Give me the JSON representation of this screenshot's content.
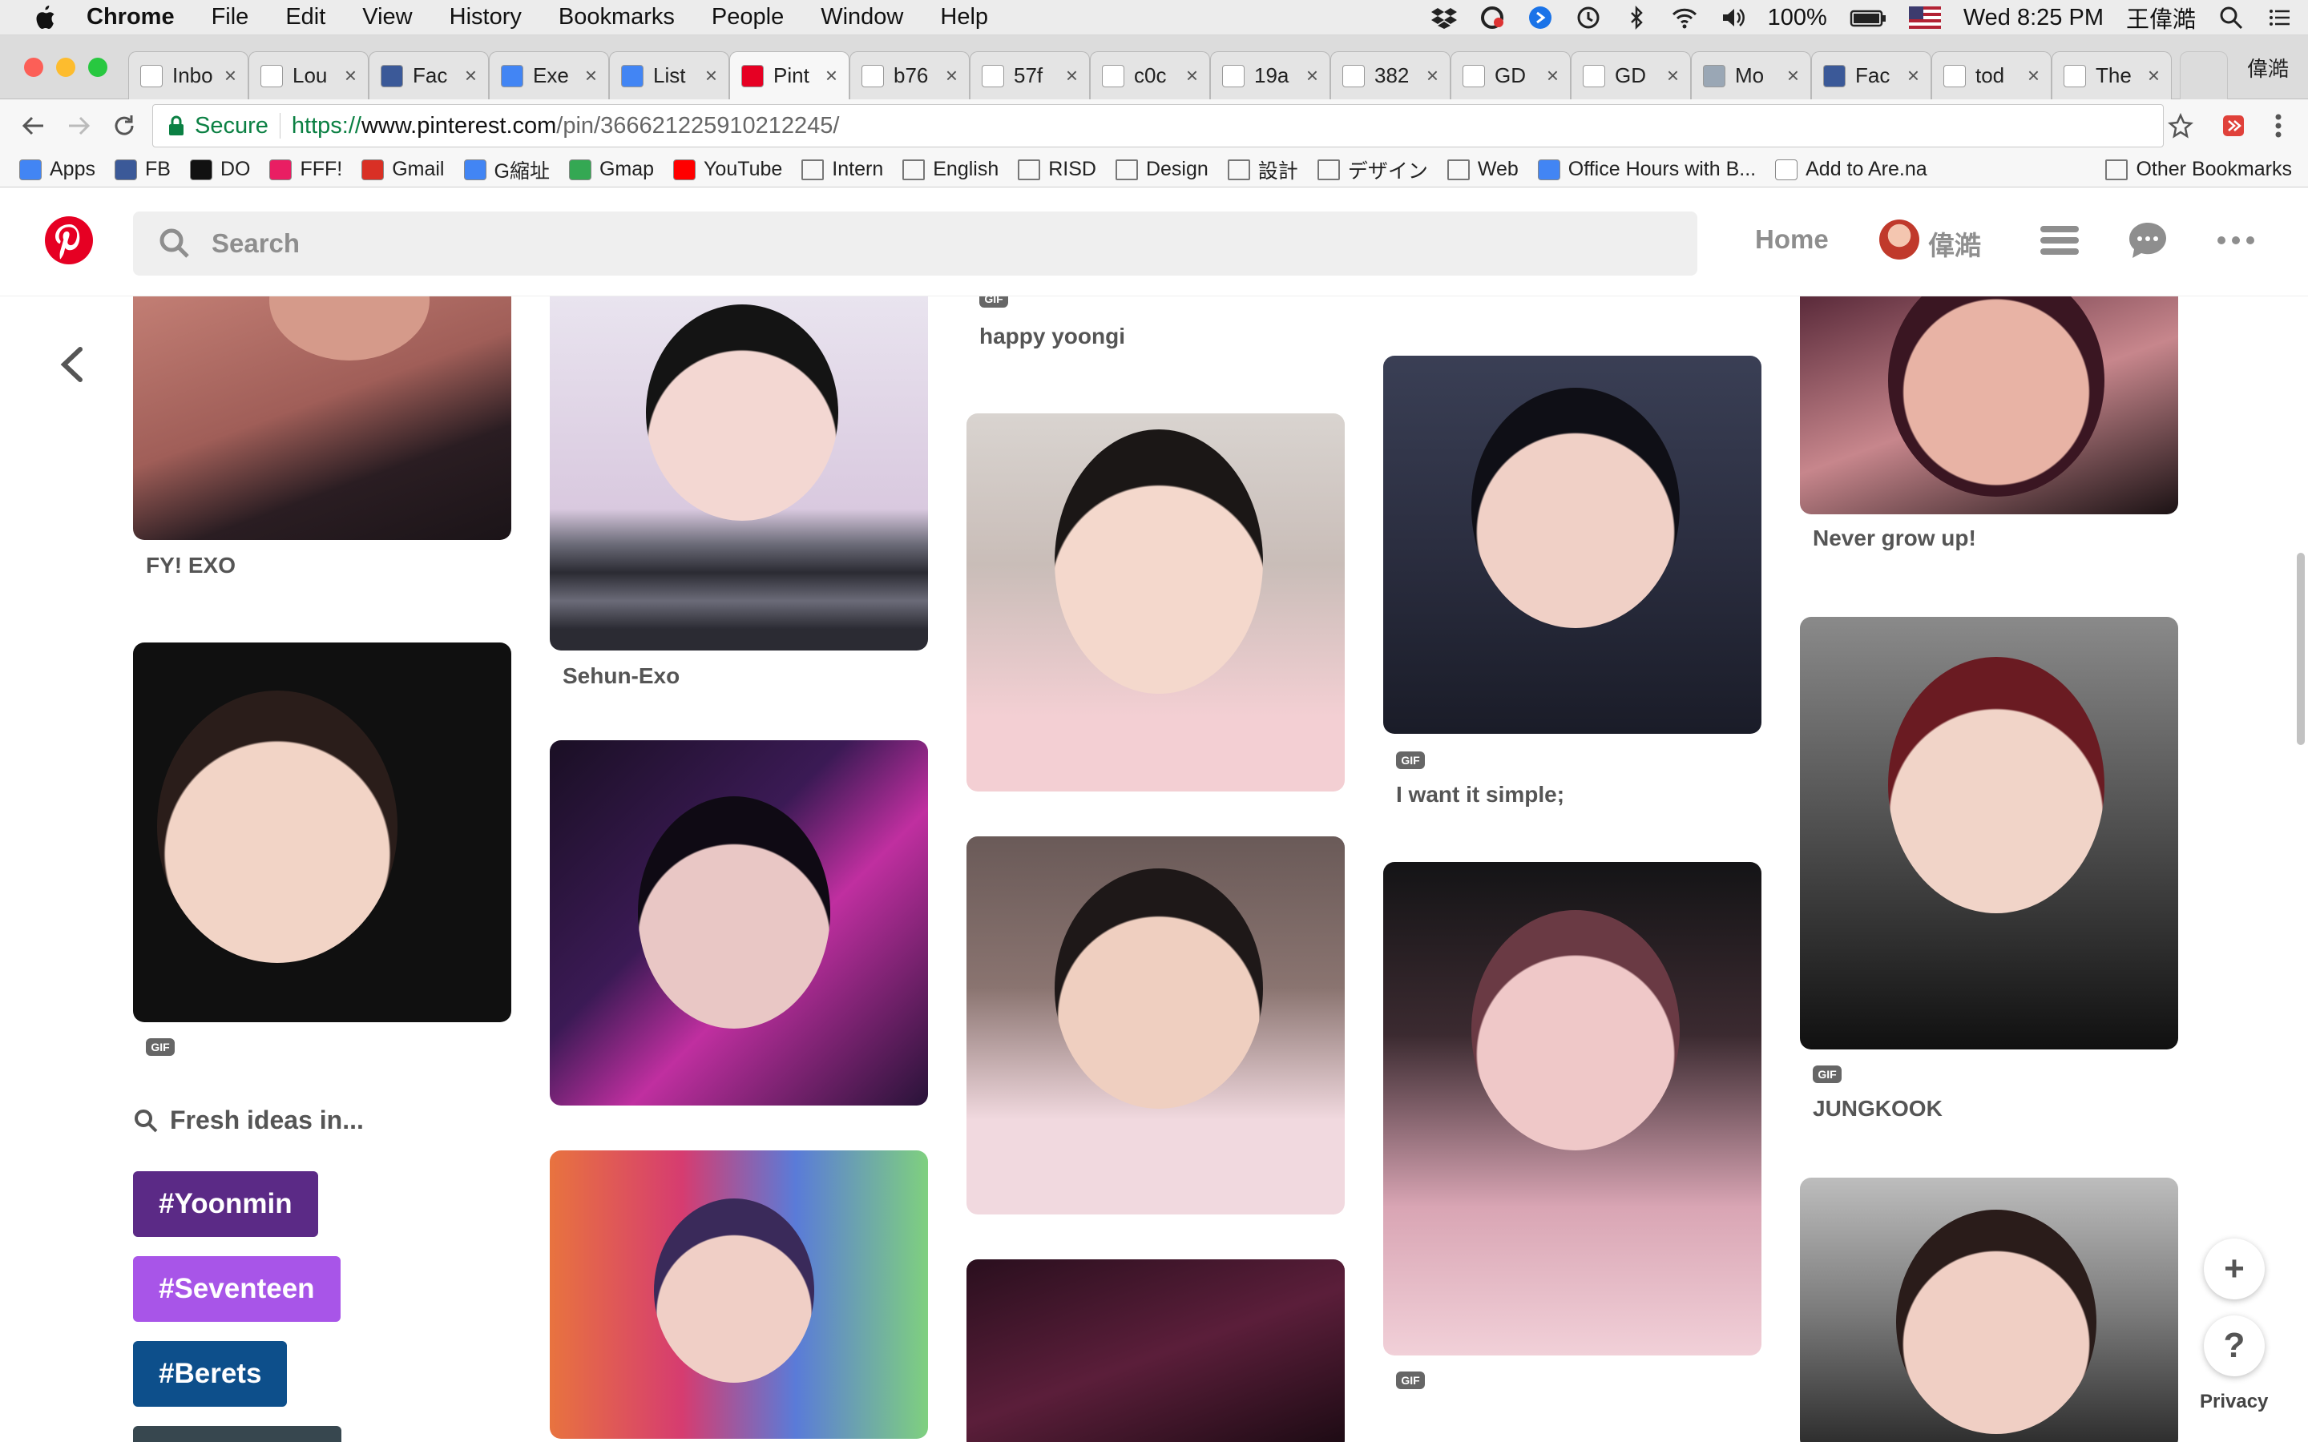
{
  "menubar": {
    "app": "Chrome",
    "items": [
      "File",
      "Edit",
      "View",
      "History",
      "Bookmarks",
      "People",
      "Window",
      "Help"
    ],
    "battery": "100%",
    "clock": "Wed 8:25 PM",
    "user": "王偉澔"
  },
  "tabs": [
    {
      "label": "Inbo",
      "icon": "gmail-icon"
    },
    {
      "label": "Lou",
      "icon": "gmail-icon"
    },
    {
      "label": "Fac",
      "icon": "facebook-icon"
    },
    {
      "label": "Exe",
      "icon": "docs-icon"
    },
    {
      "label": "List",
      "icon": "docs-icon"
    },
    {
      "label": "Pint",
      "icon": "pinterest-icon",
      "active": true
    },
    {
      "label": "b76",
      "icon": "page-icon"
    },
    {
      "label": "57f",
      "icon": "page-icon"
    },
    {
      "label": "c0c",
      "icon": "page-icon"
    },
    {
      "label": "19a",
      "icon": "page-icon"
    },
    {
      "label": "382",
      "icon": "page-icon"
    },
    {
      "label": "GD",
      "icon": "page-icon"
    },
    {
      "label": "GD",
      "icon": "page-icon"
    },
    {
      "label": "Mo",
      "icon": "image-icon"
    },
    {
      "label": "Fac",
      "icon": "facebook-icon"
    },
    {
      "label": "tod",
      "icon": "google-icon"
    },
    {
      "label": "The",
      "icon": "wikipedia-icon"
    }
  ],
  "profile_name": "偉澔",
  "address": {
    "secure_label": "Secure",
    "protocol": "https://",
    "host": "www.pinterest.com",
    "path": "/pin/366621225910212245/"
  },
  "bookmarks": [
    {
      "label": "Apps",
      "icon": "apps-icon"
    },
    {
      "label": "FB",
      "icon": "facebook-icon"
    },
    {
      "label": "DO",
      "icon": "do-icon"
    },
    {
      "label": "FFF!",
      "icon": "fff-icon"
    },
    {
      "label": "Gmail",
      "icon": "gmail-icon"
    },
    {
      "label": "G縮址",
      "icon": "google-icon"
    },
    {
      "label": "Gmap",
      "icon": "maps-icon"
    },
    {
      "label": "YouTube",
      "icon": "youtube-icon"
    },
    {
      "label": "Intern",
      "icon": "folder-icon"
    },
    {
      "label": "English",
      "icon": "folder-icon"
    },
    {
      "label": "RISD",
      "icon": "folder-icon"
    },
    {
      "label": "Design",
      "icon": "folder-icon"
    },
    {
      "label": "設計",
      "icon": "folder-icon"
    },
    {
      "label": "デザイン",
      "icon": "folder-icon"
    },
    {
      "label": "Web",
      "icon": "folder-icon"
    },
    {
      "label": "Office Hours with B...",
      "icon": "docs-icon"
    },
    {
      "label": "Add to Are.na",
      "icon": "page-icon"
    }
  ],
  "other_bookmarks": "Other Bookmarks",
  "pinterest": {
    "search_placeholder": "Search",
    "home": "Home",
    "user": "偉澔"
  },
  "gif_badge": "GIF",
  "pins": {
    "col1_top_title": "FY! EXO",
    "col2_top_title": "Sehun-Exo",
    "col3_top_title": "happy yoongi",
    "col4_top_title": "I want it simple;",
    "col5_top_title": "Never grow up!",
    "col5_mid_title": "JUNGKOOK"
  },
  "fresh_ideas": {
    "heading": "Fresh ideas in...",
    "tags": [
      {
        "label": "#Yoonmin",
        "color": "#5b2a86"
      },
      {
        "label": "#Seventeen",
        "color": "#a855e8"
      },
      {
        "label": "#Berets",
        "color": "#0d4f8b"
      }
    ]
  },
  "fab": {
    "plus": "+",
    "help": "?",
    "privacy": "Privacy"
  },
  "colors": {
    "pinterest_red": "#e60023",
    "secure_green": "#0b8043"
  }
}
